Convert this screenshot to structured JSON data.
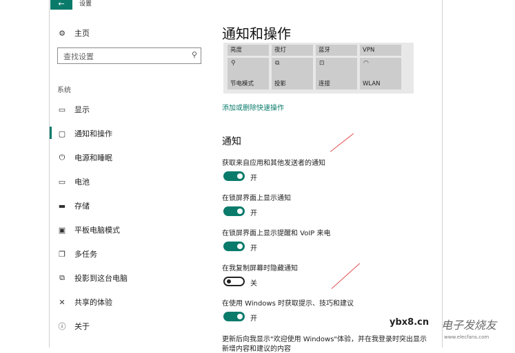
{
  "window": {
    "title": "设置",
    "back_glyph": "←"
  },
  "sidebar": {
    "home_label": "主页",
    "search_placeholder": "查找设置",
    "section_label": "系统",
    "items": [
      {
        "label": "显示",
        "icon": "monitor-icon",
        "glyph": "▭"
      },
      {
        "label": "通知和操作",
        "icon": "notification-icon",
        "glyph": "▢",
        "active": true
      },
      {
        "label": "电源和睡眠",
        "icon": "power-icon",
        "glyph": "⏻"
      },
      {
        "label": "电池",
        "icon": "battery-icon",
        "glyph": "▭"
      },
      {
        "label": "存储",
        "icon": "storage-icon",
        "glyph": "▬"
      },
      {
        "label": "平板电脑模式",
        "icon": "tablet-icon",
        "glyph": "▣"
      },
      {
        "label": "多任务",
        "icon": "multitask-icon",
        "glyph": "❐"
      },
      {
        "label": "投影到这台电脑",
        "icon": "project-icon",
        "glyph": "⧉"
      },
      {
        "label": "共享的体验",
        "icon": "share-icon",
        "glyph": "✕"
      },
      {
        "label": "关于",
        "icon": "info-icon",
        "glyph": "ⓘ"
      }
    ]
  },
  "main": {
    "title": "通知和操作",
    "quick_actions": [
      {
        "label": "亮度",
        "glyph": ""
      },
      {
        "label": "夜灯",
        "glyph": ""
      },
      {
        "label": "蓝牙",
        "glyph": ""
      },
      {
        "label": "VPN",
        "glyph": ""
      },
      {
        "label": "节电模式",
        "glyph": "⚲"
      },
      {
        "label": "投影",
        "glyph": "⧉"
      },
      {
        "label": "连接",
        "glyph": "⊡"
      },
      {
        "label": "WLAN",
        "glyph": "◠"
      }
    ],
    "add_remove_link": "添加或删除快速操作",
    "notifications_heading": "通知",
    "settings": [
      {
        "label": "获取来自应用和其他发送者的通知",
        "state": "开",
        "on": true
      },
      {
        "label": "在锁屏界面上显示通知",
        "state": "开",
        "on": true
      },
      {
        "label": "在锁屏界面上显示提醒和 VoIP 来电",
        "state": "开",
        "on": true
      },
      {
        "label": "在我复制屏幕时隐藏通知",
        "state": "关",
        "on": false
      },
      {
        "label": "在使用 Windows 时获取提示、技巧和建议",
        "state": "开",
        "on": true
      }
    ],
    "truncated_text": "更新后向我显示\"欢迎使用 Windows\"体验，并在我登录时突出显示",
    "truncated_text_2": "新增内容和建议的内容"
  },
  "watermark": {
    "site": "ybx8.cn",
    "brand": "电子发烧友",
    "url": "www.elecfans.com"
  },
  "colors": {
    "accent": "#0a7b6b",
    "tile": "#cccccc",
    "annotation": "#e05050"
  }
}
